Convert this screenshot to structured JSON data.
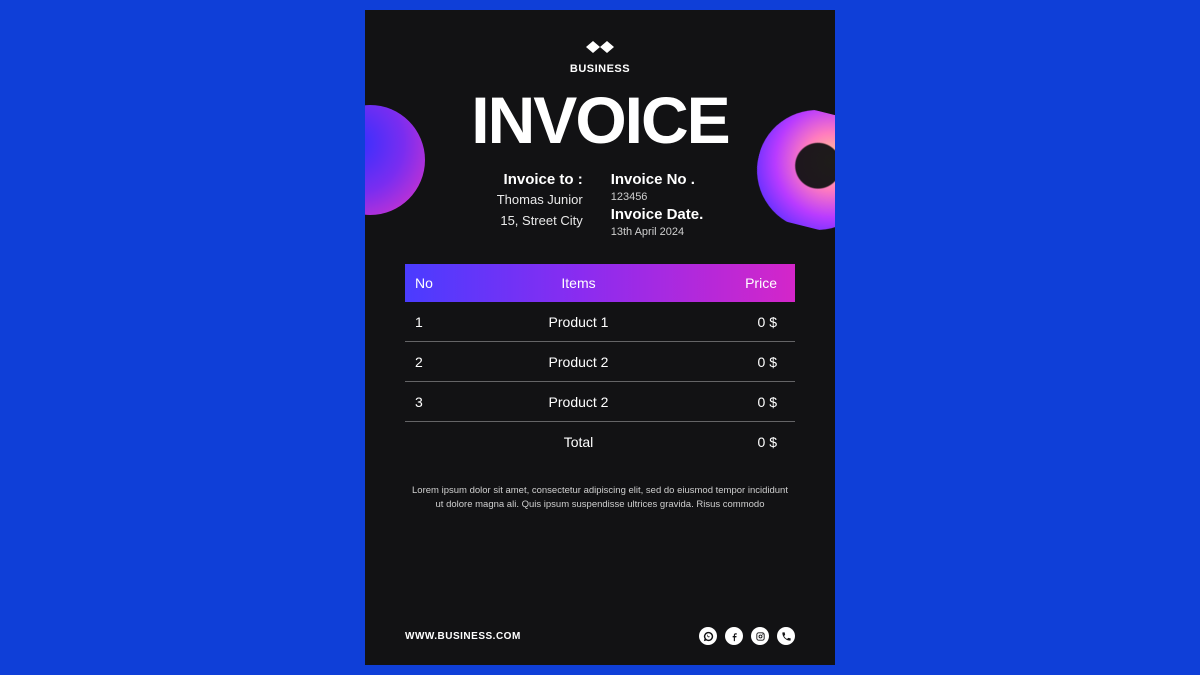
{
  "logo_text": "BUSINESS",
  "title": "INVOICE",
  "invoice_to": {
    "label": "Invoice to :",
    "name": "Thomas Junior",
    "address": "15, Street City"
  },
  "invoice_meta": {
    "no_label": "Invoice No .",
    "no_value": "123456",
    "date_label": "Invoice Date.",
    "date_value": "13th April  2024"
  },
  "table": {
    "headers": {
      "no": "No",
      "items": "Items",
      "price": "Price"
    },
    "rows": [
      {
        "no": "1",
        "item": "Product 1",
        "price": "0 $"
      },
      {
        "no": "2",
        "item": "Product 2",
        "price": "0 $"
      },
      {
        "no": "3",
        "item": "Product 2",
        "price": "0 $"
      }
    ],
    "total_label": "Total",
    "total_value": "0 $"
  },
  "blurb": "Lorem ipsum dolor sit amet, consectetur adipiscing elit, sed do eiusmod tempor incididunt ut dolore magna ali. Quis ipsum suspendisse ultrices gravida. Risus commodo",
  "footer": {
    "url": "WWW.BUSINESS.COM",
    "social": [
      "whatsapp-icon",
      "facebook-icon",
      "instagram-icon",
      "phone-icon"
    ]
  }
}
